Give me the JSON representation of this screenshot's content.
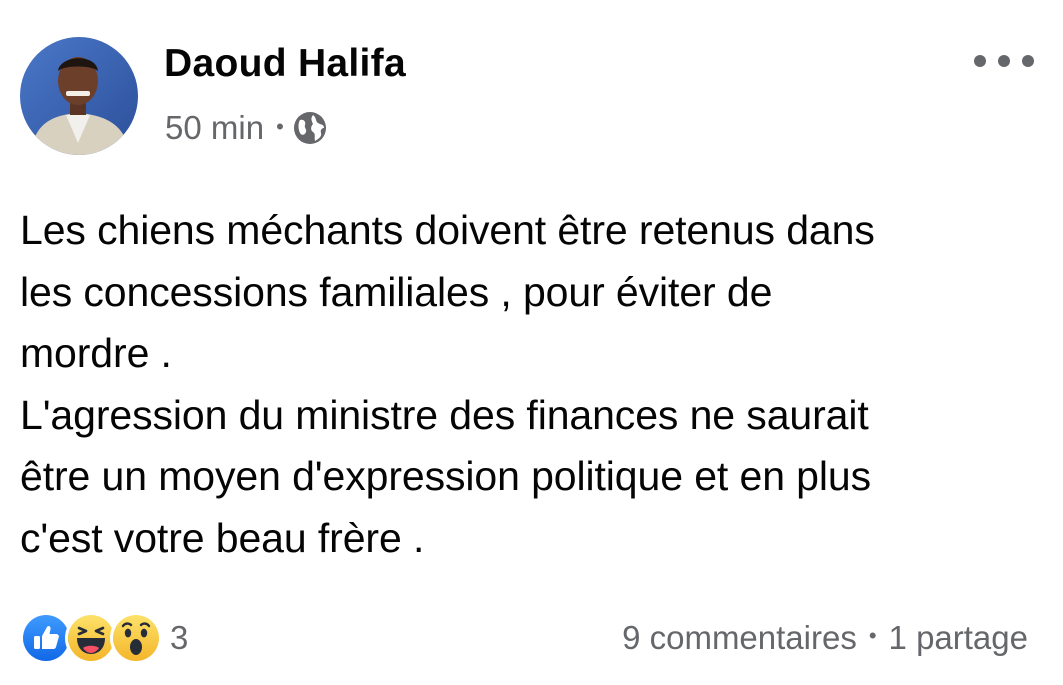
{
  "post": {
    "author": {
      "name": "Daoud Halifa",
      "avatar_icon": "profile-photo"
    },
    "meta": {
      "time": "50 min",
      "separator": "•",
      "privacy_icon": "globe-icon"
    },
    "more_icon": "more-horizontal-icon",
    "text_lines": [
      "Les chiens méchants doivent être retenus dans",
      "les concessions familiales , pour éviter de",
      "mordre .",
      "L'agression du ministre des finances ne saurait",
      "être un moyen d'expression politique et en plus",
      "c'est votre beau frère ."
    ],
    "reactions": {
      "icons": [
        "like-icon",
        "haha-icon",
        "wow-icon"
      ],
      "count": "3"
    },
    "stats": {
      "comments": "9 commentaires",
      "separator": "•",
      "shares": "1 partage"
    }
  },
  "colors": {
    "text_primary": "#050505",
    "text_secondary": "#65676b",
    "like_blue": "#1877f2",
    "emoji_yellow": "#f7c844"
  }
}
